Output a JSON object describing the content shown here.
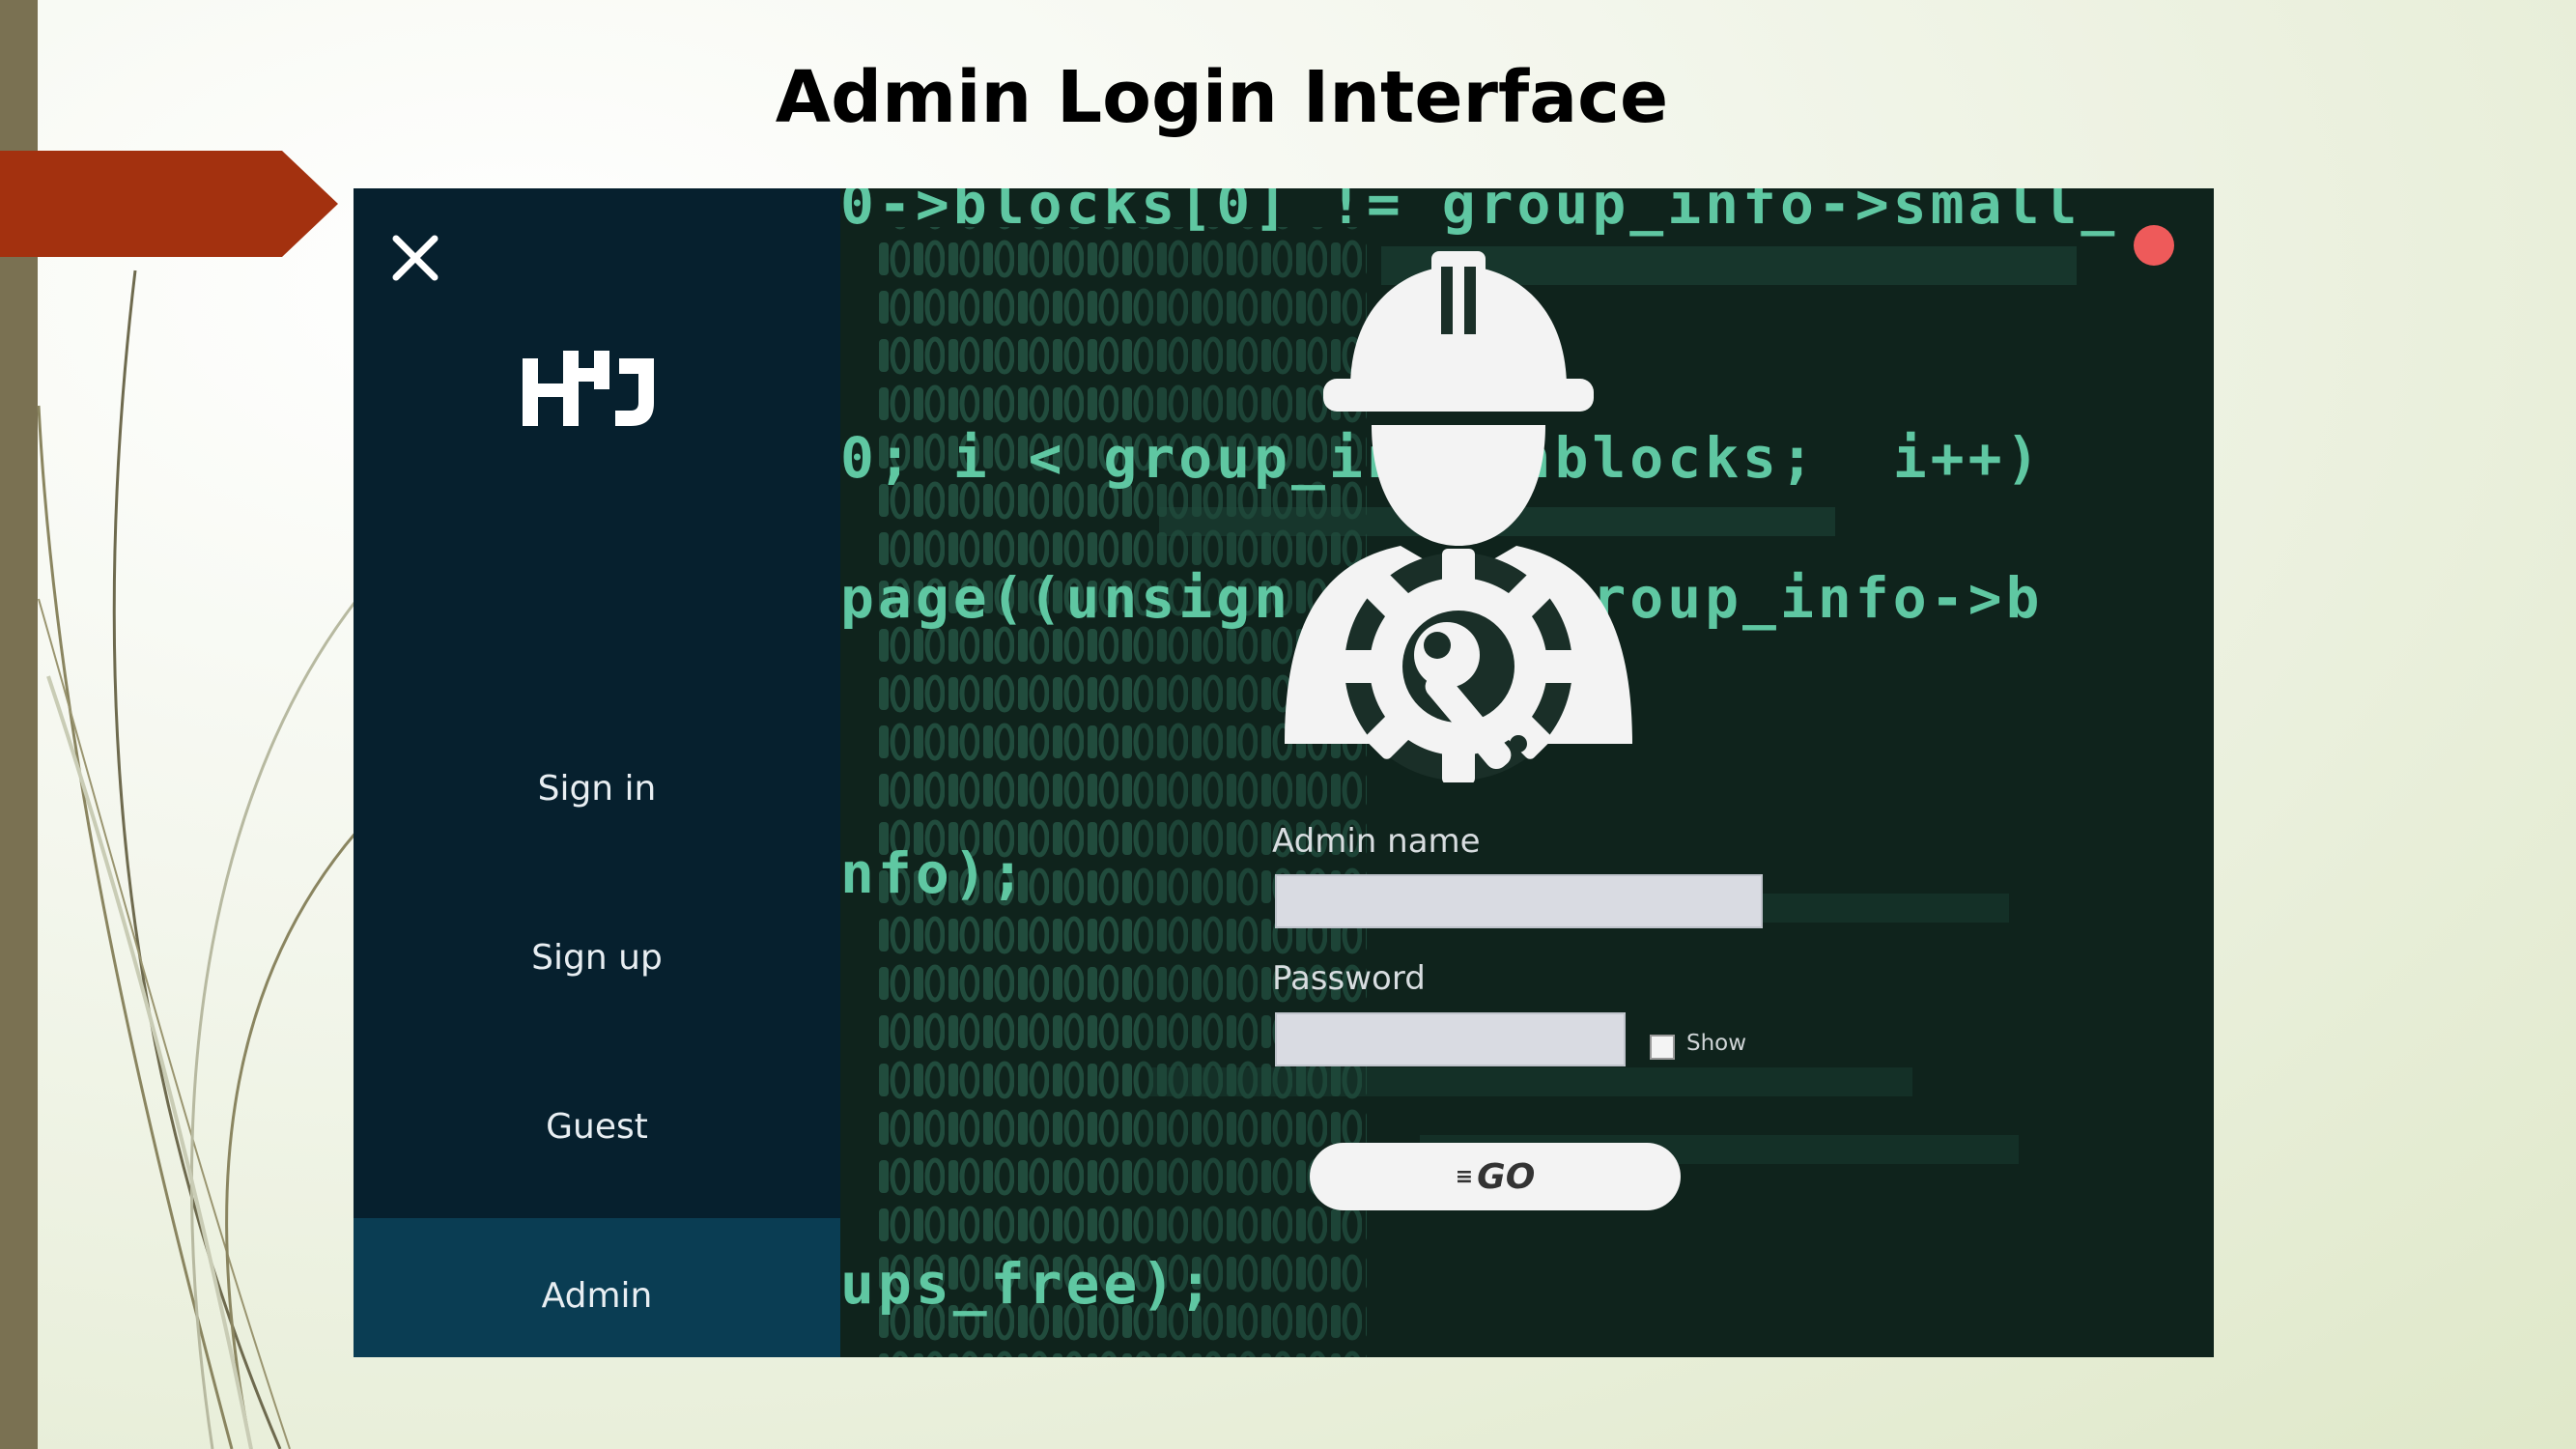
{
  "slide": {
    "title": "Admin Login Interface",
    "colors": {
      "left_bar": "#7a7152",
      "arrow": "#a3310f"
    }
  },
  "app": {
    "logo_text": "HJ",
    "close_icon": "close-icon",
    "sidebar": {
      "items": [
        {
          "label": "Sign in",
          "active": false
        },
        {
          "label": "Sign up",
          "active": false
        },
        {
          "label": "Guest",
          "active": false
        },
        {
          "label": "Admin",
          "active": true
        }
      ]
    },
    "main": {
      "status_dot_color": "#ee5a5a",
      "hero_icon": "admin-settings-icon",
      "code_lines": [
        "0->blocks[0] != group_info->small_",
        "0; i < group_in  >nblocks;  i++)",
        "page((unsign       group_info->b",
        "nfo);",
        "ups_free);"
      ],
      "admin_name_label": "Admin name",
      "admin_name_value": "",
      "password_label": "Password",
      "password_value": "",
      "show_label": "Show",
      "show_checked": false,
      "go_label": "GO"
    }
  }
}
